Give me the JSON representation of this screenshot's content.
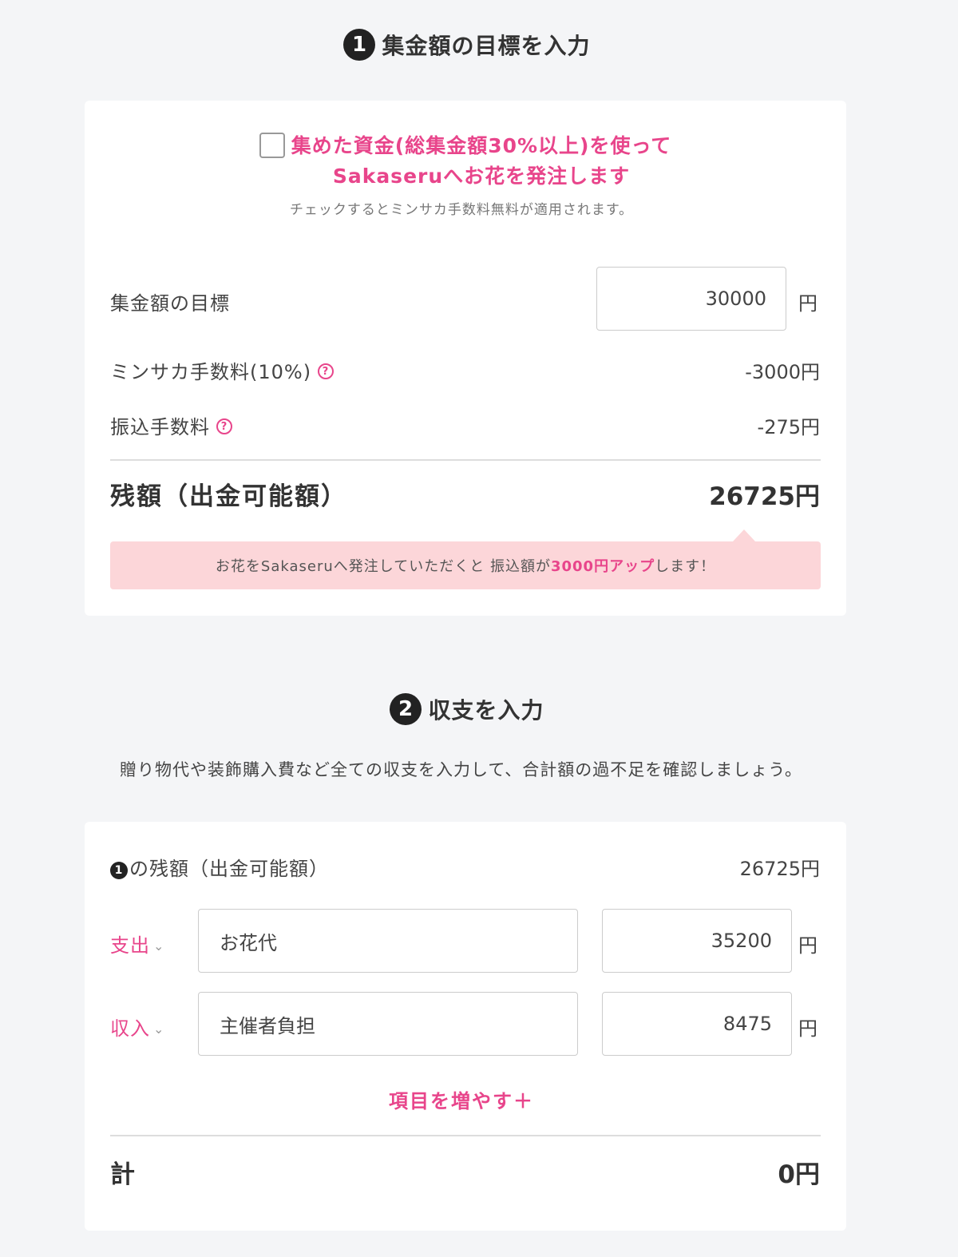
{
  "step1": {
    "number": "1",
    "title": "集金額の目標を入力",
    "checkbox": {
      "checked": false,
      "label_line1": "集めた資金(総集金額30%以上)を使って",
      "label_line2": "Sakaseruへお花を発注します",
      "note": "チェックするとミンサカ手数料無料が適用されます。"
    },
    "goal": {
      "label": "集金額の目標",
      "value": "30000",
      "unit": "円"
    },
    "fee": {
      "label": "ミンサカ手数料(10%)",
      "value": "-3000円"
    },
    "transfer_fee": {
      "label": "振込手数料",
      "value": "-275円"
    },
    "balance": {
      "label": "残額（出金可能額）",
      "value": "26725円"
    },
    "notice": {
      "prefix": "お花をSakaseruへ発注していただくと 振込額が",
      "highlight": "3000円アップ",
      "suffix": "します！"
    }
  },
  "step2": {
    "number": "2",
    "title": "収支を入力",
    "description": "贈り物代や装飾購入費など全ての収支を入力して、合計額の過不足を確認しましょう。",
    "carried_balance": {
      "badge": "1",
      "label": "の残額（出金可能額）",
      "value": "26725円"
    },
    "items": [
      {
        "type": "支出",
        "name": "お花代",
        "amount": "35200",
        "unit": "円"
      },
      {
        "type": "収入",
        "name": "主催者負担",
        "amount": "8475",
        "unit": "円"
      }
    ],
    "add_item": "項目を増やす＋",
    "total": {
      "label": "計",
      "value": "0円"
    }
  },
  "colors": {
    "accent": "#e8458b",
    "notice_bg": "#fcd6d9",
    "page_bg": "#f4f5f7"
  },
  "icons": {
    "help": "question-circle-icon",
    "chevron": "chevron-down-icon"
  }
}
